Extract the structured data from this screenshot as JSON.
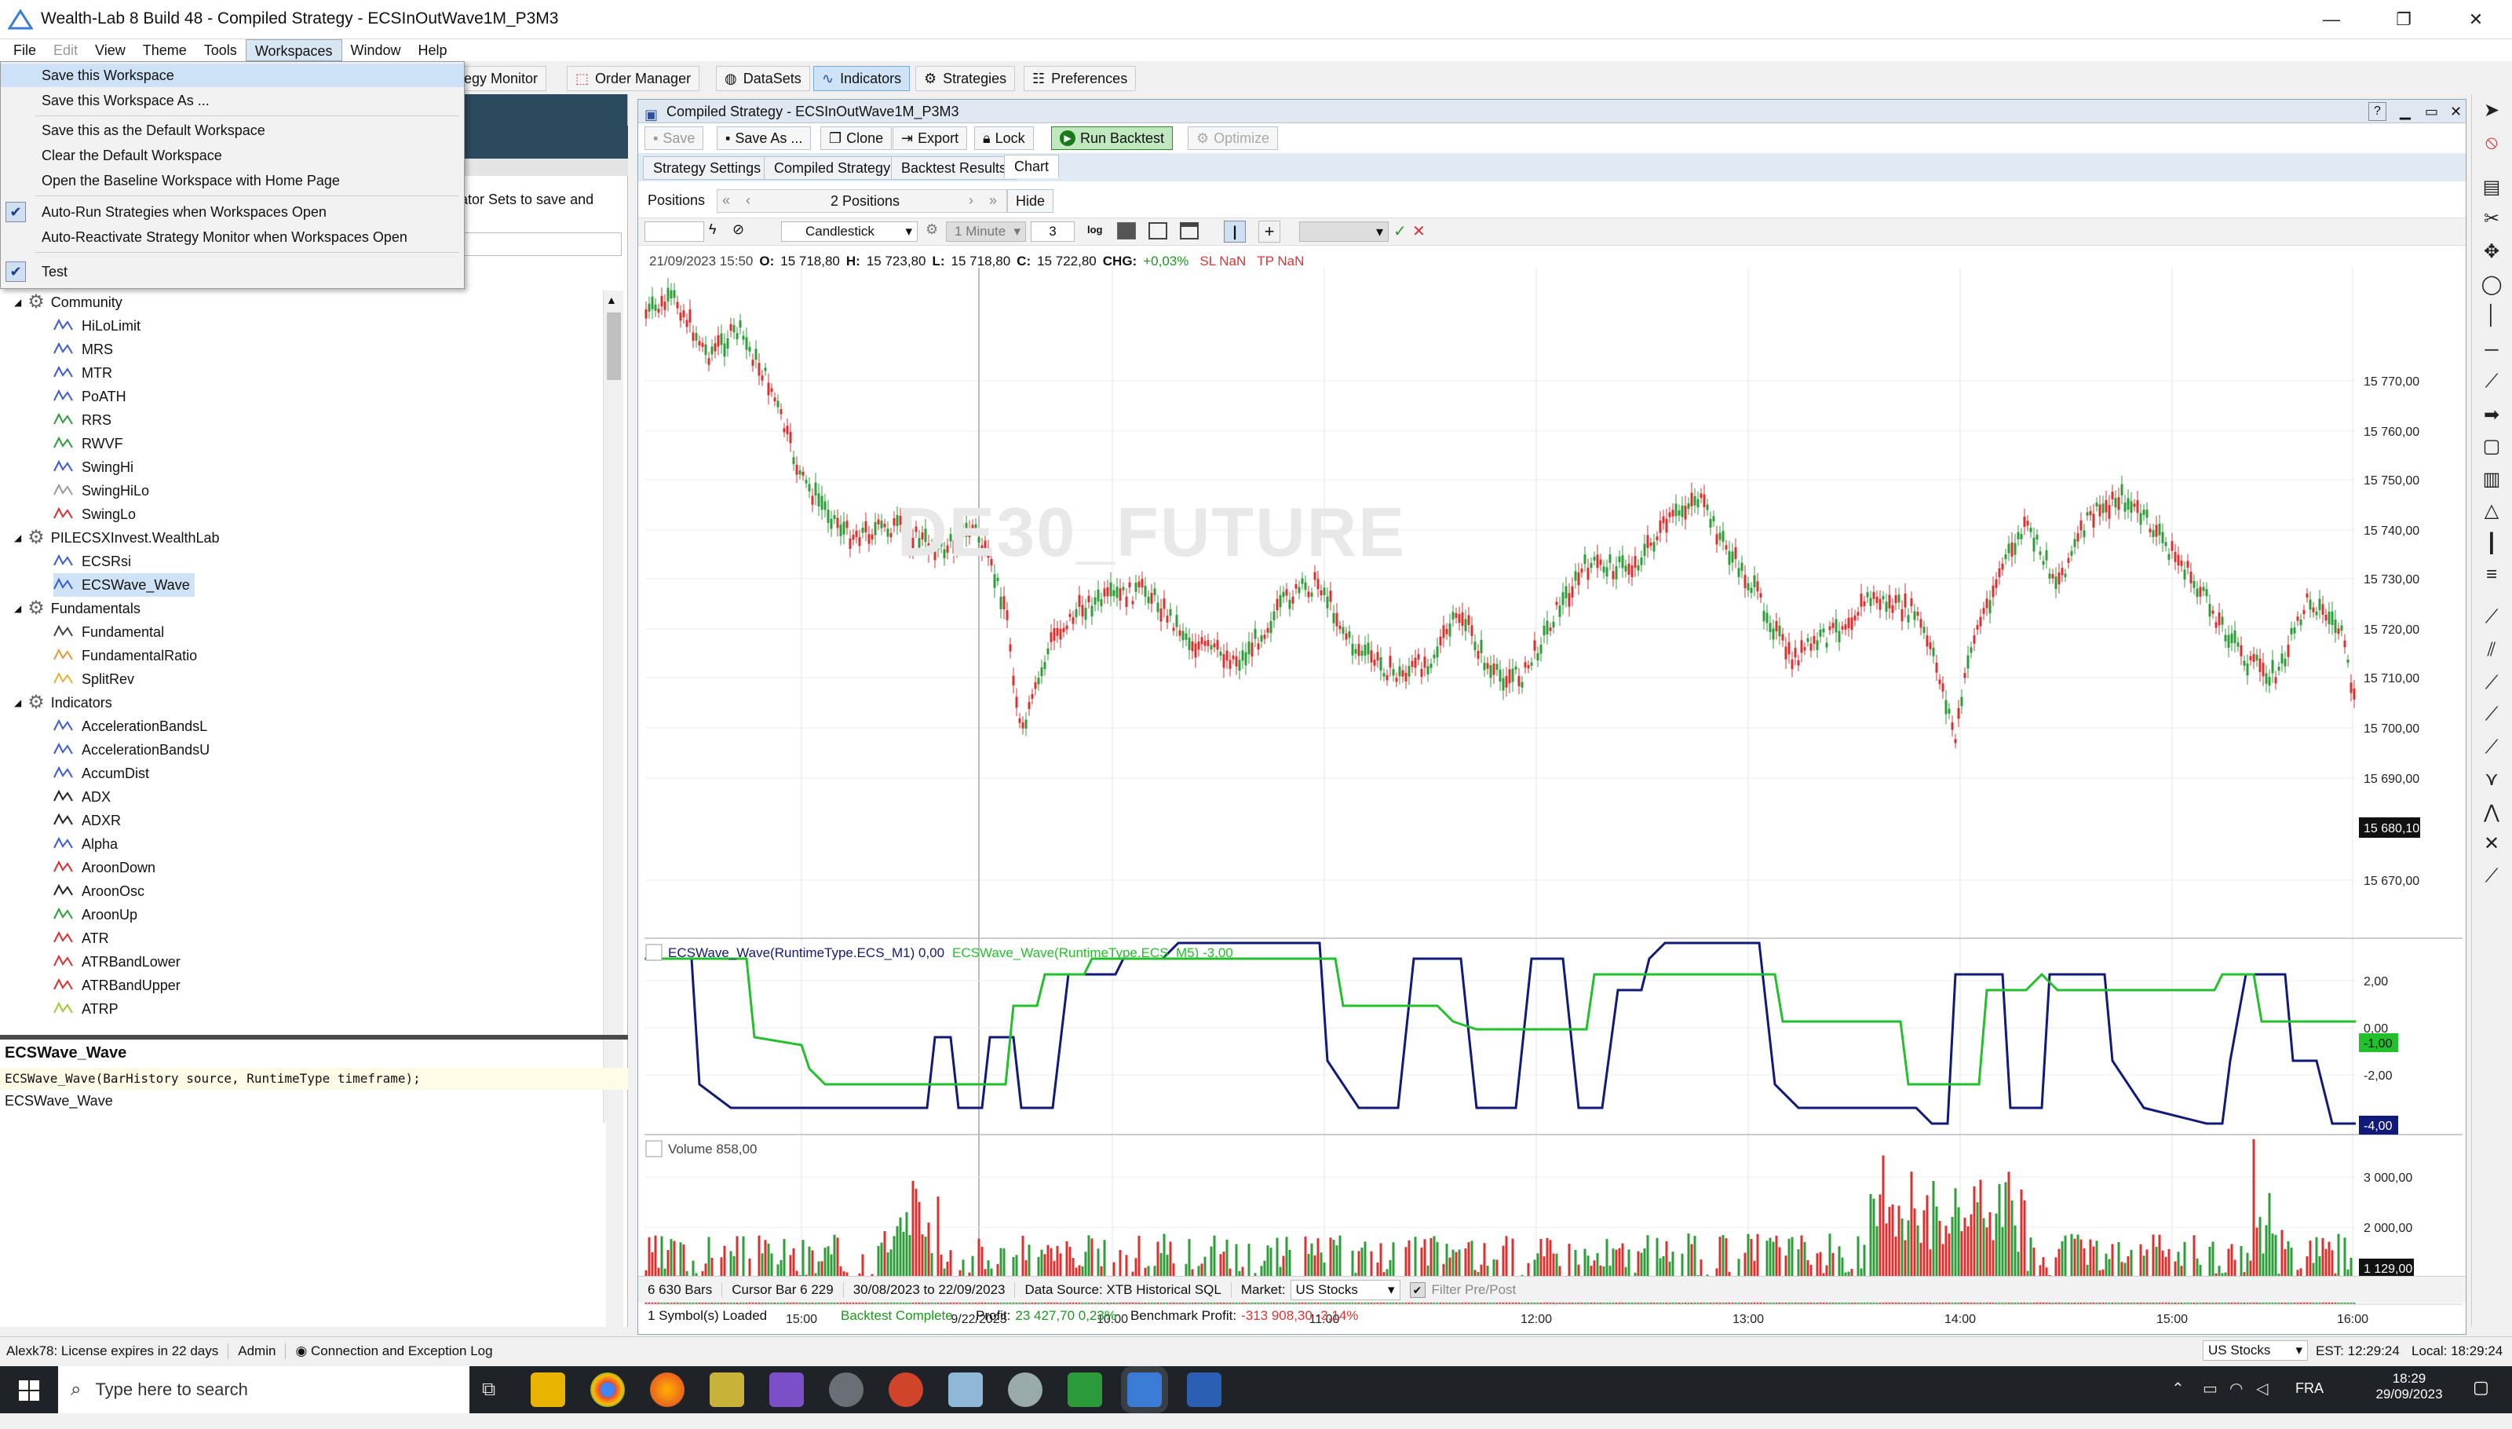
{
  "window": {
    "title": "Wealth-Lab 8 Build 48 - Compiled Strategy - ECSInOutWave1M_P3M3",
    "controls": [
      "—",
      "❐",
      "✕"
    ]
  },
  "menubar": [
    "File",
    "Edit",
    "View",
    "Theme",
    "Tools",
    "Workspaces",
    "Window",
    "Help"
  ],
  "toolbar": {
    "strategy_monitor": "rategy Monitor",
    "order_manager": "Order Manager",
    "datasets": "DataSets",
    "indicators": "Indicators",
    "strategies": "Strategies",
    "preferences": "Preferences"
  },
  "workspaces_menu": [
    {
      "label": "Save this Workspace",
      "checked": false
    },
    {
      "label": "Save this Workspace As ...",
      "checked": false
    },
    {
      "label": "Save this as the Default Workspace",
      "checked": false
    },
    {
      "label": "Clear the Default Workspace",
      "checked": false
    },
    {
      "label": "Open the Baseline Workspace with Home Page",
      "checked": false
    },
    {
      "label": "Auto-Run Strategies when Workspaces Open",
      "checked": true
    },
    {
      "label": "Auto-Reactivate Strategy Monitor when Workspaces Open",
      "checked": false
    },
    {
      "label": "Test",
      "checked": true
    }
  ],
  "left_panel": {
    "behind_text": "ator Sets to save and",
    "tree": [
      {
        "label": "Community",
        "type": "group"
      },
      {
        "label": "HiLoLimit",
        "color": "#3b5bd6"
      },
      {
        "label": "MRS",
        "color": "#3b5bd6"
      },
      {
        "label": "MTR",
        "color": "#3b5bd6"
      },
      {
        "label": "PoATH",
        "color": "#3b5bd6"
      },
      {
        "label": "RRS",
        "color": "#2e9e3a"
      },
      {
        "label": "RWVF",
        "color": "#2e9e3a"
      },
      {
        "label": "SwingHi",
        "color": "#3b5bd6"
      },
      {
        "label": "SwingHiLo",
        "color": "#999999"
      },
      {
        "label": "SwingLo",
        "color": "#d93030"
      },
      {
        "label": "PILECSXInvest.WealthLab",
        "type": "group"
      },
      {
        "label": "ECSRsi",
        "color": "#3b5bd6"
      },
      {
        "label": "ECSWave_Wave",
        "color": "#3b5bd6",
        "selected": true
      },
      {
        "label": "Fundamentals",
        "type": "group"
      },
      {
        "label": "Fundamental",
        "color": "#444444"
      },
      {
        "label": "FundamentalRatio",
        "color": "#e69a3a"
      },
      {
        "label": "SplitRev",
        "color": "#e6b23a"
      },
      {
        "label": "Indicators",
        "type": "group"
      },
      {
        "label": "AccelerationBandsL",
        "color": "#3b5bd6"
      },
      {
        "label": "AccelerationBandsU",
        "color": "#3b5bd6"
      },
      {
        "label": "AccumDist",
        "color": "#3b5bd6"
      },
      {
        "label": "ADX",
        "color": "#222222"
      },
      {
        "label": "ADXR",
        "color": "#222222"
      },
      {
        "label": "Alpha",
        "color": "#3b5bd6"
      },
      {
        "label": "AroonDown",
        "color": "#d93030"
      },
      {
        "label": "AroonOsc",
        "color": "#222222"
      },
      {
        "label": "AroonUp",
        "color": "#2e9e3a"
      },
      {
        "label": "ATR",
        "color": "#d93030"
      },
      {
        "label": "ATRBandLower",
        "color": "#d93030"
      },
      {
        "label": "ATRBandUpper",
        "color": "#d93030"
      },
      {
        "label": "ATRP",
        "color": "#9acd32"
      }
    ],
    "detail": {
      "title": "ECSWave_Wave",
      "signature": "ECSWave_Wave(BarHistory source, RuntimeType timeframe);",
      "description": "ECSWave_Wave"
    }
  },
  "chart_window": {
    "title": "Compiled Strategy - ECSInOutWave1M_P3M3",
    "buttons": {
      "save": "Save",
      "save_as": "Save As ...",
      "clone": "Clone",
      "export": "Export",
      "lock": "Lock",
      "run": "Run Backtest",
      "optimize": "Optimize"
    },
    "tabs": [
      "Strategy Settings",
      "Compiled Strategy",
      "Backtest Results",
      "Chart"
    ],
    "positions_label": "Positions",
    "positions_value": "2 Positions",
    "hide": "Hide",
    "chart_style": "Candlestick",
    "timeframe": "1 Minute",
    "interval": "3",
    "log": "log",
    "ohlc": {
      "date": "21/09/2023 15:50",
      "o_label": "O:",
      "o": "15 718,80",
      "h_label": "H:",
      "h": "15 723,80",
      "l_label": "L:",
      "l": "15 718,80",
      "c_label": "C:",
      "c": "15 722,80",
      "chg_label": "CHG:",
      "chg": "+0,03%",
      "sl": "SL NaN",
      "tp": "TP NaN"
    },
    "watermark": "DE30_FUTURE",
    "price_axis": [
      "15 770,00",
      "15 760,00",
      "15 750,00",
      "15 740,00",
      "15 730,00",
      "15 720,00",
      "15 710,00",
      "15 700,00",
      "15 690,00",
      "15 680,10",
      "15 670,00"
    ],
    "current_price": "15 680,10",
    "indicator_pane": {
      "label1": "ECSWave_Wave(RuntimeType.ECS_M1) 0,00",
      "label2": "ECSWave_Wave(RuntimeType.ECS_M5) -3,00",
      "axis": [
        "2,00",
        "0,00",
        "-2,00"
      ],
      "green_value": "-1,00",
      "blue_value": "-4,00"
    },
    "volume_pane": {
      "label": "Volume 858,00",
      "axis": [
        "3 000,00",
        "2 000,00"
      ],
      "current": "1 129,00"
    },
    "time_axis": [
      "15:00",
      "9/22/2023",
      "10:00",
      "11:00",
      "12:00",
      "13:00",
      "14:00",
      "15:00",
      "16:00"
    ],
    "info_bar": {
      "bars": "6 630 Bars",
      "cursor": "Cursor Bar 6 229",
      "range": "30/08/2023 to 22/09/2023",
      "source": "Data Source: XTB Historical SQL",
      "market_label": "Market:",
      "market": "US Stocks",
      "filter": "Filter Pre/Post"
    },
    "status": {
      "symbols": "1 Symbol(s) Loaded",
      "backtest": "Backtest Complete",
      "profit_label": "Profit:",
      "profit": "23 427,70 0,23%",
      "bench_label": "Benchmark Profit:",
      "bench": "-313 908,30 -3,14%"
    }
  },
  "status_bar": {
    "license": "Alexk78: License expires in 22 days",
    "admin": "Admin",
    "log": "Connection and Exception Log",
    "market": "US Stocks",
    "est": "EST: 12:29:24",
    "local": "Local: 18:29:24"
  },
  "taskbar": {
    "search": "Type here to search",
    "lang": "FRA",
    "time": "18:29",
    "date": "29/09/2023"
  },
  "colors": {
    "up": "#2e9e3a",
    "down": "#d93030",
    "wave_m1": "#101a7a",
    "wave_m5": "#22c02a",
    "accent": "#2b4a5e"
  }
}
